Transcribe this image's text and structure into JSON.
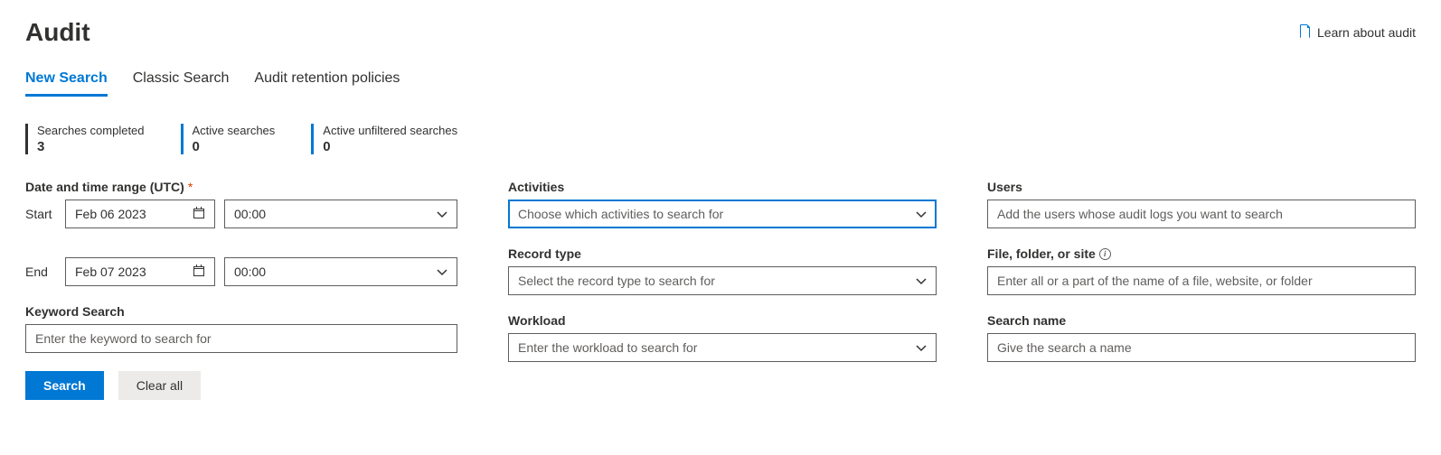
{
  "header": {
    "title": "Audit",
    "learn_link": "Learn about audit"
  },
  "tabs": {
    "new_search": "New Search",
    "classic_search": "Classic Search",
    "retention": "Audit retention policies"
  },
  "stats": {
    "completed_label": "Searches completed",
    "completed_value": "3",
    "active_label": "Active searches",
    "active_value": "0",
    "unfiltered_label": "Active unfiltered searches",
    "unfiltered_value": "0"
  },
  "form": {
    "date_range_label": "Date and time range (UTC)",
    "start_label": "Start",
    "start_date": "Feb 06 2023",
    "start_time": "00:00",
    "end_label": "End",
    "end_date": "Feb 07 2023",
    "end_time": "00:00",
    "keyword_label": "Keyword Search",
    "keyword_placeholder": "Enter the keyword to search for",
    "activities_label": "Activities",
    "activities_placeholder": "Choose which activities to search for",
    "record_type_label": "Record type",
    "record_type_placeholder": "Select the record type to search for",
    "workload_label": "Workload",
    "workload_placeholder": "Enter the workload to search for",
    "users_label": "Users",
    "users_placeholder": "Add the users whose audit logs you want to search",
    "file_label": "File, folder, or site",
    "file_placeholder": "Enter all or a part of the name of a file, website, or folder",
    "search_name_label": "Search name",
    "search_name_placeholder": "Give the search a name"
  },
  "actions": {
    "search": "Search",
    "clear": "Clear all"
  }
}
